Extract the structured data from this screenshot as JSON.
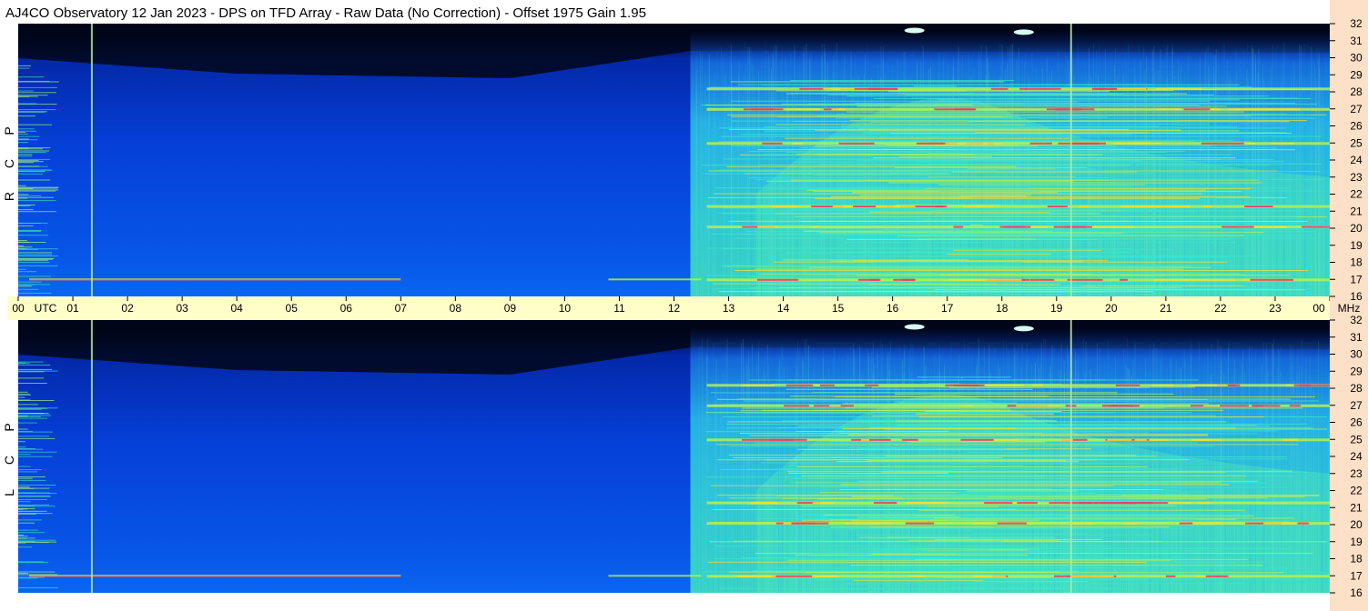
{
  "title": "AJ4CO Observatory  12 Jan 2023  -  DPS on TFD Array  -  Raw Data (No Correction)  -  Offset 1975  Gain 1.95",
  "colors": {
    "band_bg": "#fffdc8",
    "axis_bg": "#fde0c8",
    "palette": [
      "#000a2e",
      "#0432c8",
      "#0a6cf0",
      "#19b4f0",
      "#3fe6c8",
      "#b6f050",
      "#f0e030",
      "#f03a6a",
      "#ffffff"
    ]
  },
  "chart_data": {
    "type": "heatmap",
    "x_unit_label": "UTC",
    "y_unit_label": "MHz",
    "x_ticks": [
      "00",
      "01",
      "02",
      "03",
      "04",
      "05",
      "06",
      "07",
      "08",
      "09",
      "10",
      "11",
      "12",
      "13",
      "14",
      "15",
      "16",
      "17",
      "18",
      "19",
      "20",
      "21",
      "22",
      "23",
      "00"
    ],
    "x_range_hours": [
      0,
      24
    ],
    "y_ticks": [
      "16",
      "17",
      "18",
      "19",
      "20",
      "21",
      "22",
      "23",
      "24",
      "25",
      "26",
      "27",
      "28",
      "29",
      "30",
      "31",
      "32"
    ],
    "y_range_mhz": [
      16,
      32
    ],
    "panels": [
      {
        "name": "RCP",
        "label_chars": [
          "R",
          "C",
          "P"
        ]
      },
      {
        "name": "LCP",
        "label_chars": [
          "L",
          "C",
          "P"
        ]
      }
    ],
    "vertical_markers_hours": [
      1.33,
      19.25
    ],
    "notes": {
      "day_side_onset_hours": 12.3,
      "strong_emission_bands_mhz": [
        17.0,
        20.1,
        21.3,
        25.0,
        27.0,
        28.2
      ]
    }
  }
}
